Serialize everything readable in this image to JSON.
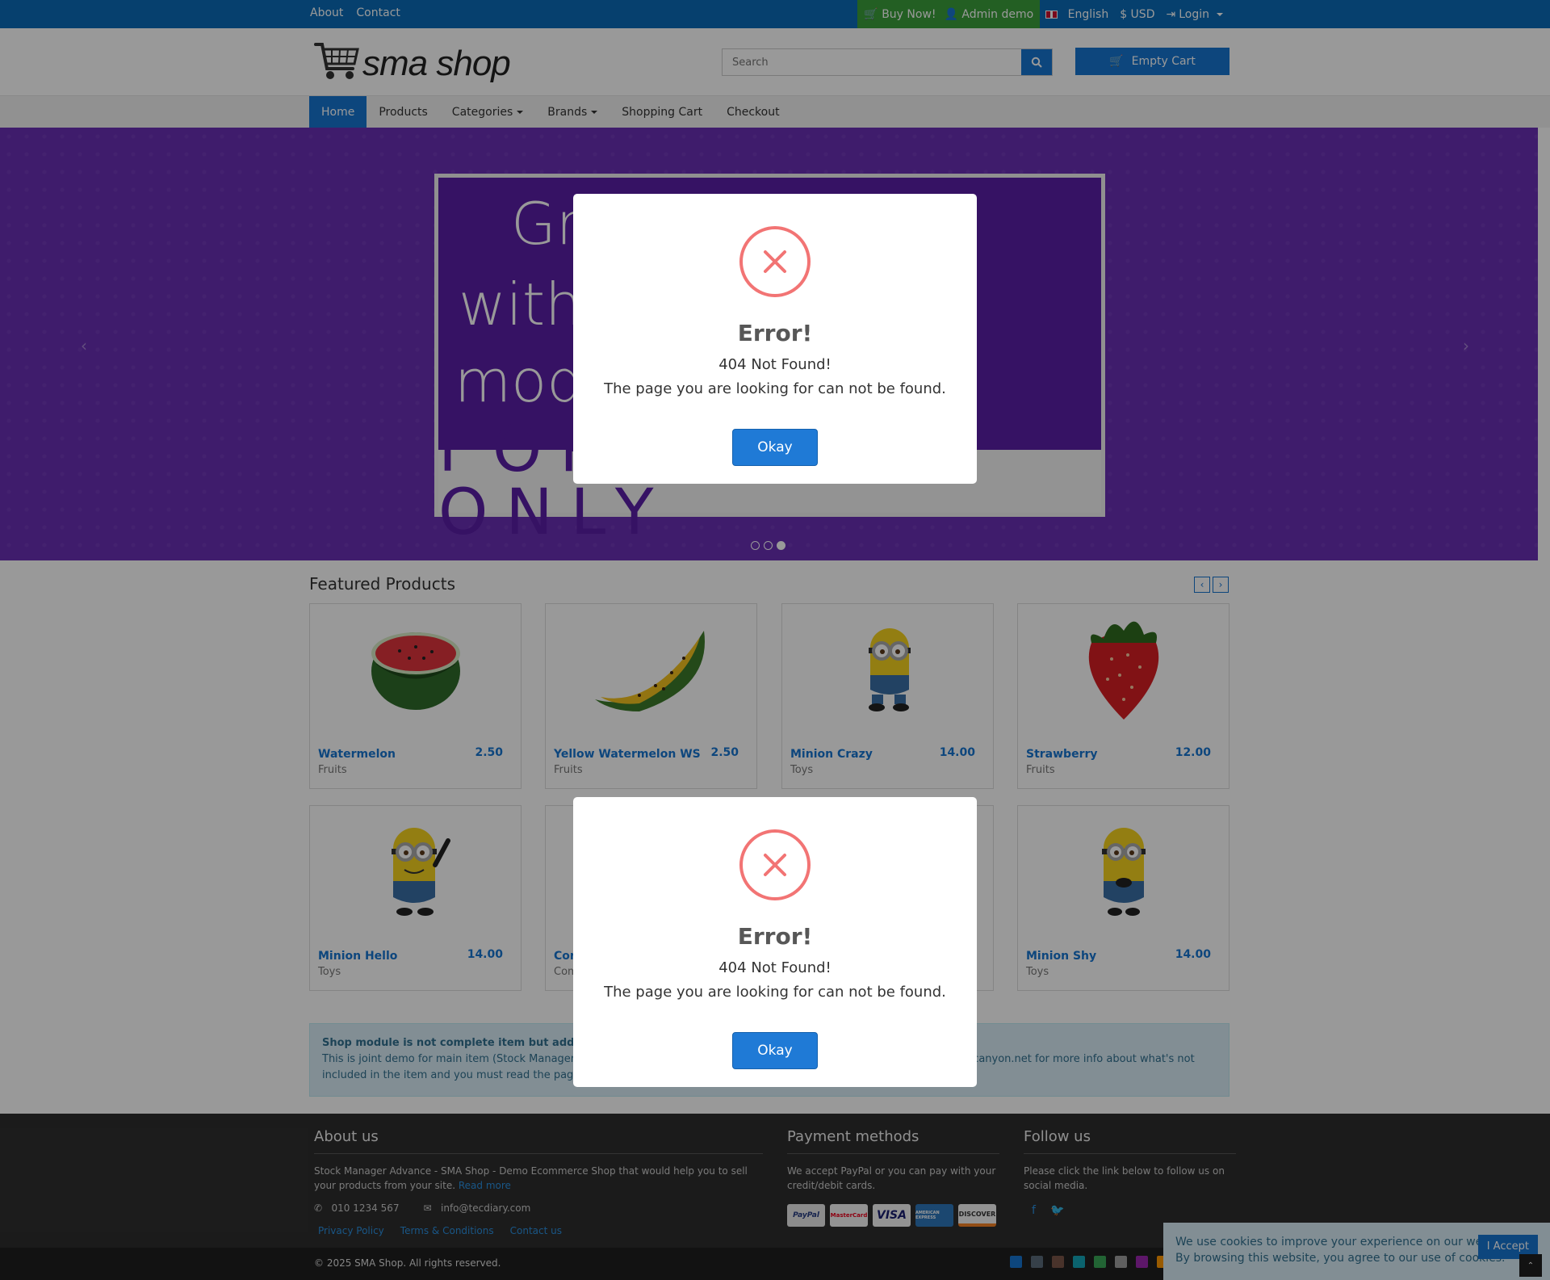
{
  "topbar": {
    "links": [
      "About",
      "Contact"
    ],
    "buy_now": "Buy Now!",
    "admin_demo": "Admin demo",
    "language": "English",
    "currency": "$ USD",
    "login": "Login"
  },
  "header": {
    "logo": "sma shop",
    "search_placeholder": "Search",
    "cart_label": "Empty Cart"
  },
  "nav": {
    "items": [
      "Home",
      "Products",
      "Categories",
      "Brands",
      "Shopping Cart",
      "Checkout"
    ]
  },
  "hero": {
    "line1": "Gr                    es",
    "line2": "with S                  cart",
    "line3": "modu                  nline!",
    "bottom": "FOR $18.00 ONLY"
  },
  "featured": {
    "title": "Featured Products",
    "products": [
      {
        "name": "Watermelon",
        "price": "2.50",
        "category": "Fruits"
      },
      {
        "name": "Yellow Watermelon WS",
        "price": "2.50",
        "category": "Fruits"
      },
      {
        "name": "Minion Crazy",
        "price": "14.00",
        "category": "Toys"
      },
      {
        "name": "Strawberry",
        "price": "12.00",
        "category": "Fruits"
      },
      {
        "name": "Minion Hello",
        "price": "14.00",
        "category": "Toys"
      },
      {
        "name": "Cor",
        "price": "",
        "category": "Com"
      },
      {
        "name": "",
        "price": "",
        "category": ""
      },
      {
        "name": "Minion Shy",
        "price": "14.00",
        "category": "Toys"
      }
    ]
  },
  "alert": {
    "title": "Shop module is not complete item but add-on t",
    "line1_start": "This is joint demo for main item (Stock Manager A",
    "line1_end": "ecanyon.net for more info about what's not",
    "line2": "included in the item and you must read the page t"
  },
  "footer": {
    "about_title": "About us",
    "about_text": "Stock Manager Advance - SMA Shop - Demo Ecommerce Shop that would help you to sell your products from your site.",
    "read_more": "Read more",
    "phone": "010 1234 567",
    "email": "info@tecdiary.com",
    "links": [
      "Privacy Policy",
      "Terms & Conditions",
      "Contact us"
    ],
    "payment_title": "Payment methods",
    "payment_text": "We accept PayPal or you can pay with your credit/debit cards.",
    "payment_cards": [
      "PayPal",
      "MasterCard",
      "VISA",
      "AMERICAN EXPRESS",
      "DISCOVER"
    ],
    "follow_title": "Follow us",
    "follow_text": "Please click the link below to follow us on social media.",
    "copyright": "© 2025 SMA Shop. All rights reserved."
  },
  "cookie": {
    "text1": "We use cookies to improve your experience on our website.",
    "text2": "By browsing this website, you agree to our use of cookies.",
    "accept": "I Accept"
  },
  "modals": [
    {
      "title": "Error!",
      "line1": "404 Not Found!",
      "line2": "The page you are looking for can not be found.",
      "button": "Okay"
    },
    {
      "title": "Error!",
      "line1": "404 Not Found!",
      "line2": "The page you are looking for can not be found.",
      "button": "Okay"
    }
  ],
  "colors": {
    "primary": "#1775d1",
    "topbar": "#0a6cb8",
    "buy_now": "#3b9e3b",
    "hero": "#6a2fb5",
    "error": "#f27474",
    "swatches": [
      "#1775d1",
      "#5a6b7b",
      "#7a5548",
      "#13a6b8",
      "#3aa757",
      "#9e9e9e",
      "#9c27b0",
      "#ff9800"
    ]
  }
}
